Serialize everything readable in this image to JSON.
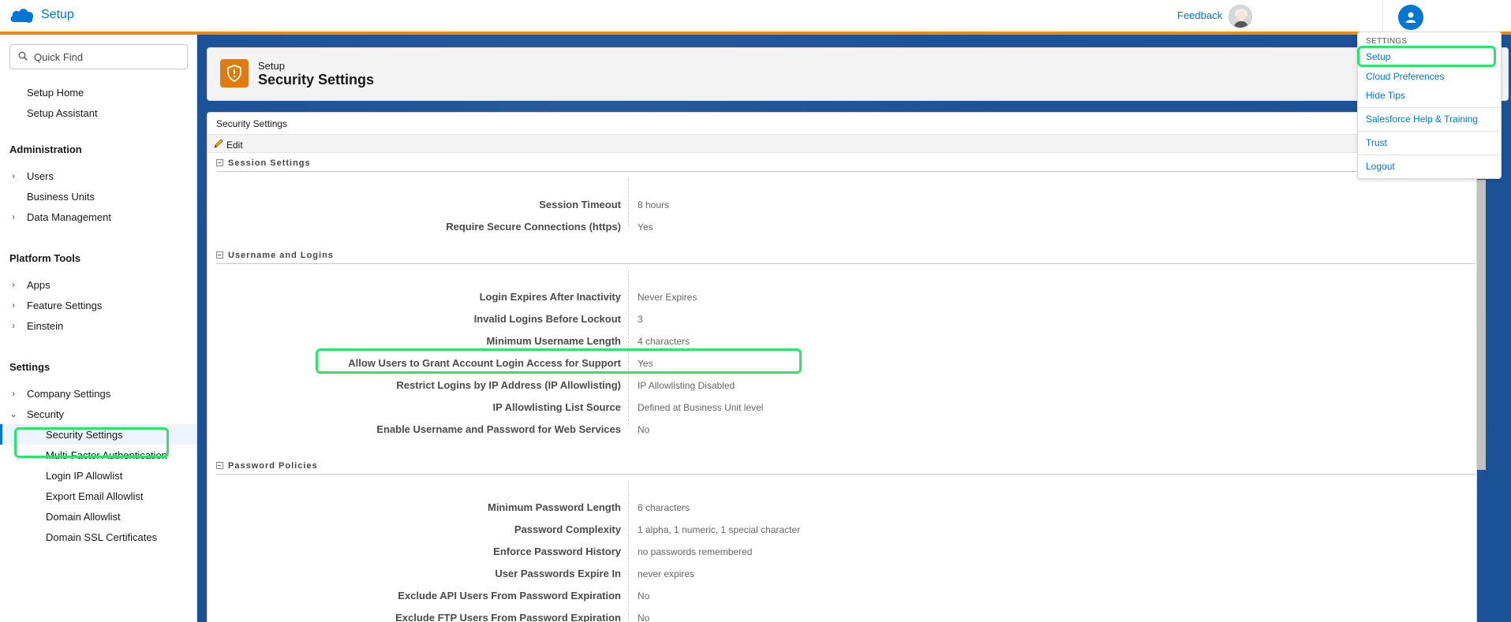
{
  "header": {
    "title": "Setup",
    "feedback": "Feedback"
  },
  "sidebar": {
    "quick_find_placeholder": "Quick Find",
    "setup_home": "Setup Home",
    "setup_assistant": "Setup Assistant",
    "administration": "Administration",
    "users": "Users",
    "business_units": "Business Units",
    "data_management": "Data Management",
    "platform_tools": "Platform Tools",
    "apps": "Apps",
    "feature_settings": "Feature Settings",
    "einstein": "Einstein",
    "settings": "Settings",
    "company_settings": "Company Settings",
    "security": "Security",
    "security_children": [
      "Security Settings",
      "Multi-Factor Authentication",
      "Login IP Allowlist",
      "Export Email Allowlist",
      "Domain Allowlist",
      "Domain SSL Certificates"
    ]
  },
  "page_header": {
    "eyebrow": "Setup",
    "title": "Security Settings"
  },
  "content": {
    "title": "Security Settings",
    "edit": "Edit",
    "sections": {
      "session": {
        "title": "Session Settings",
        "rows": [
          {
            "label": "Session Timeout",
            "value": "8 hours"
          },
          {
            "label": "Require Secure Connections (https)",
            "value": "Yes"
          }
        ]
      },
      "logins": {
        "title": "Username and Logins",
        "rows": [
          {
            "label": "Login Expires After Inactivity",
            "value": "Never Expires"
          },
          {
            "label": "Invalid Logins Before Lockout",
            "value": "3"
          },
          {
            "label": "Minimum Username Length",
            "value": "4 characters"
          },
          {
            "label": "Allow Users to Grant Account Login Access for Support",
            "value": "Yes"
          },
          {
            "label": "Restrict Logins by IP Address (IP Allowlisting)",
            "value": "IP Allowlisting Disabled"
          },
          {
            "label": "IP Allowlisting List Source",
            "value": "Defined at Business Unit level"
          },
          {
            "label": "Enable Username and Password for Web Services",
            "value": "No"
          }
        ]
      },
      "password": {
        "title": "Password Policies",
        "rows": [
          {
            "label": "Minimum Password Length",
            "value": "6 characters"
          },
          {
            "label": "Password Complexity",
            "value": "1 alpha, 1 numeric, 1 special character"
          },
          {
            "label": "Enforce Password History",
            "value": "no passwords remembered"
          },
          {
            "label": "User Passwords Expire In",
            "value": "never expires"
          },
          {
            "label": "Exclude API Users From Password Expiration",
            "value": "No"
          },
          {
            "label": "Exclude FTP Users From Password Expiration",
            "value": "No"
          }
        ]
      }
    }
  },
  "user_menu": {
    "section": "SETTINGS",
    "items": [
      "Setup",
      "Cloud Preferences",
      "Hide Tips",
      "Salesforce Help & Training",
      "Trust",
      "Logout"
    ]
  },
  "colors": {
    "brand": "#0176d3",
    "header_stripe": "#f28b00",
    "page_icon": "#e07b0f",
    "highlight": "#2ee26b",
    "main_background": "#1b5297"
  }
}
